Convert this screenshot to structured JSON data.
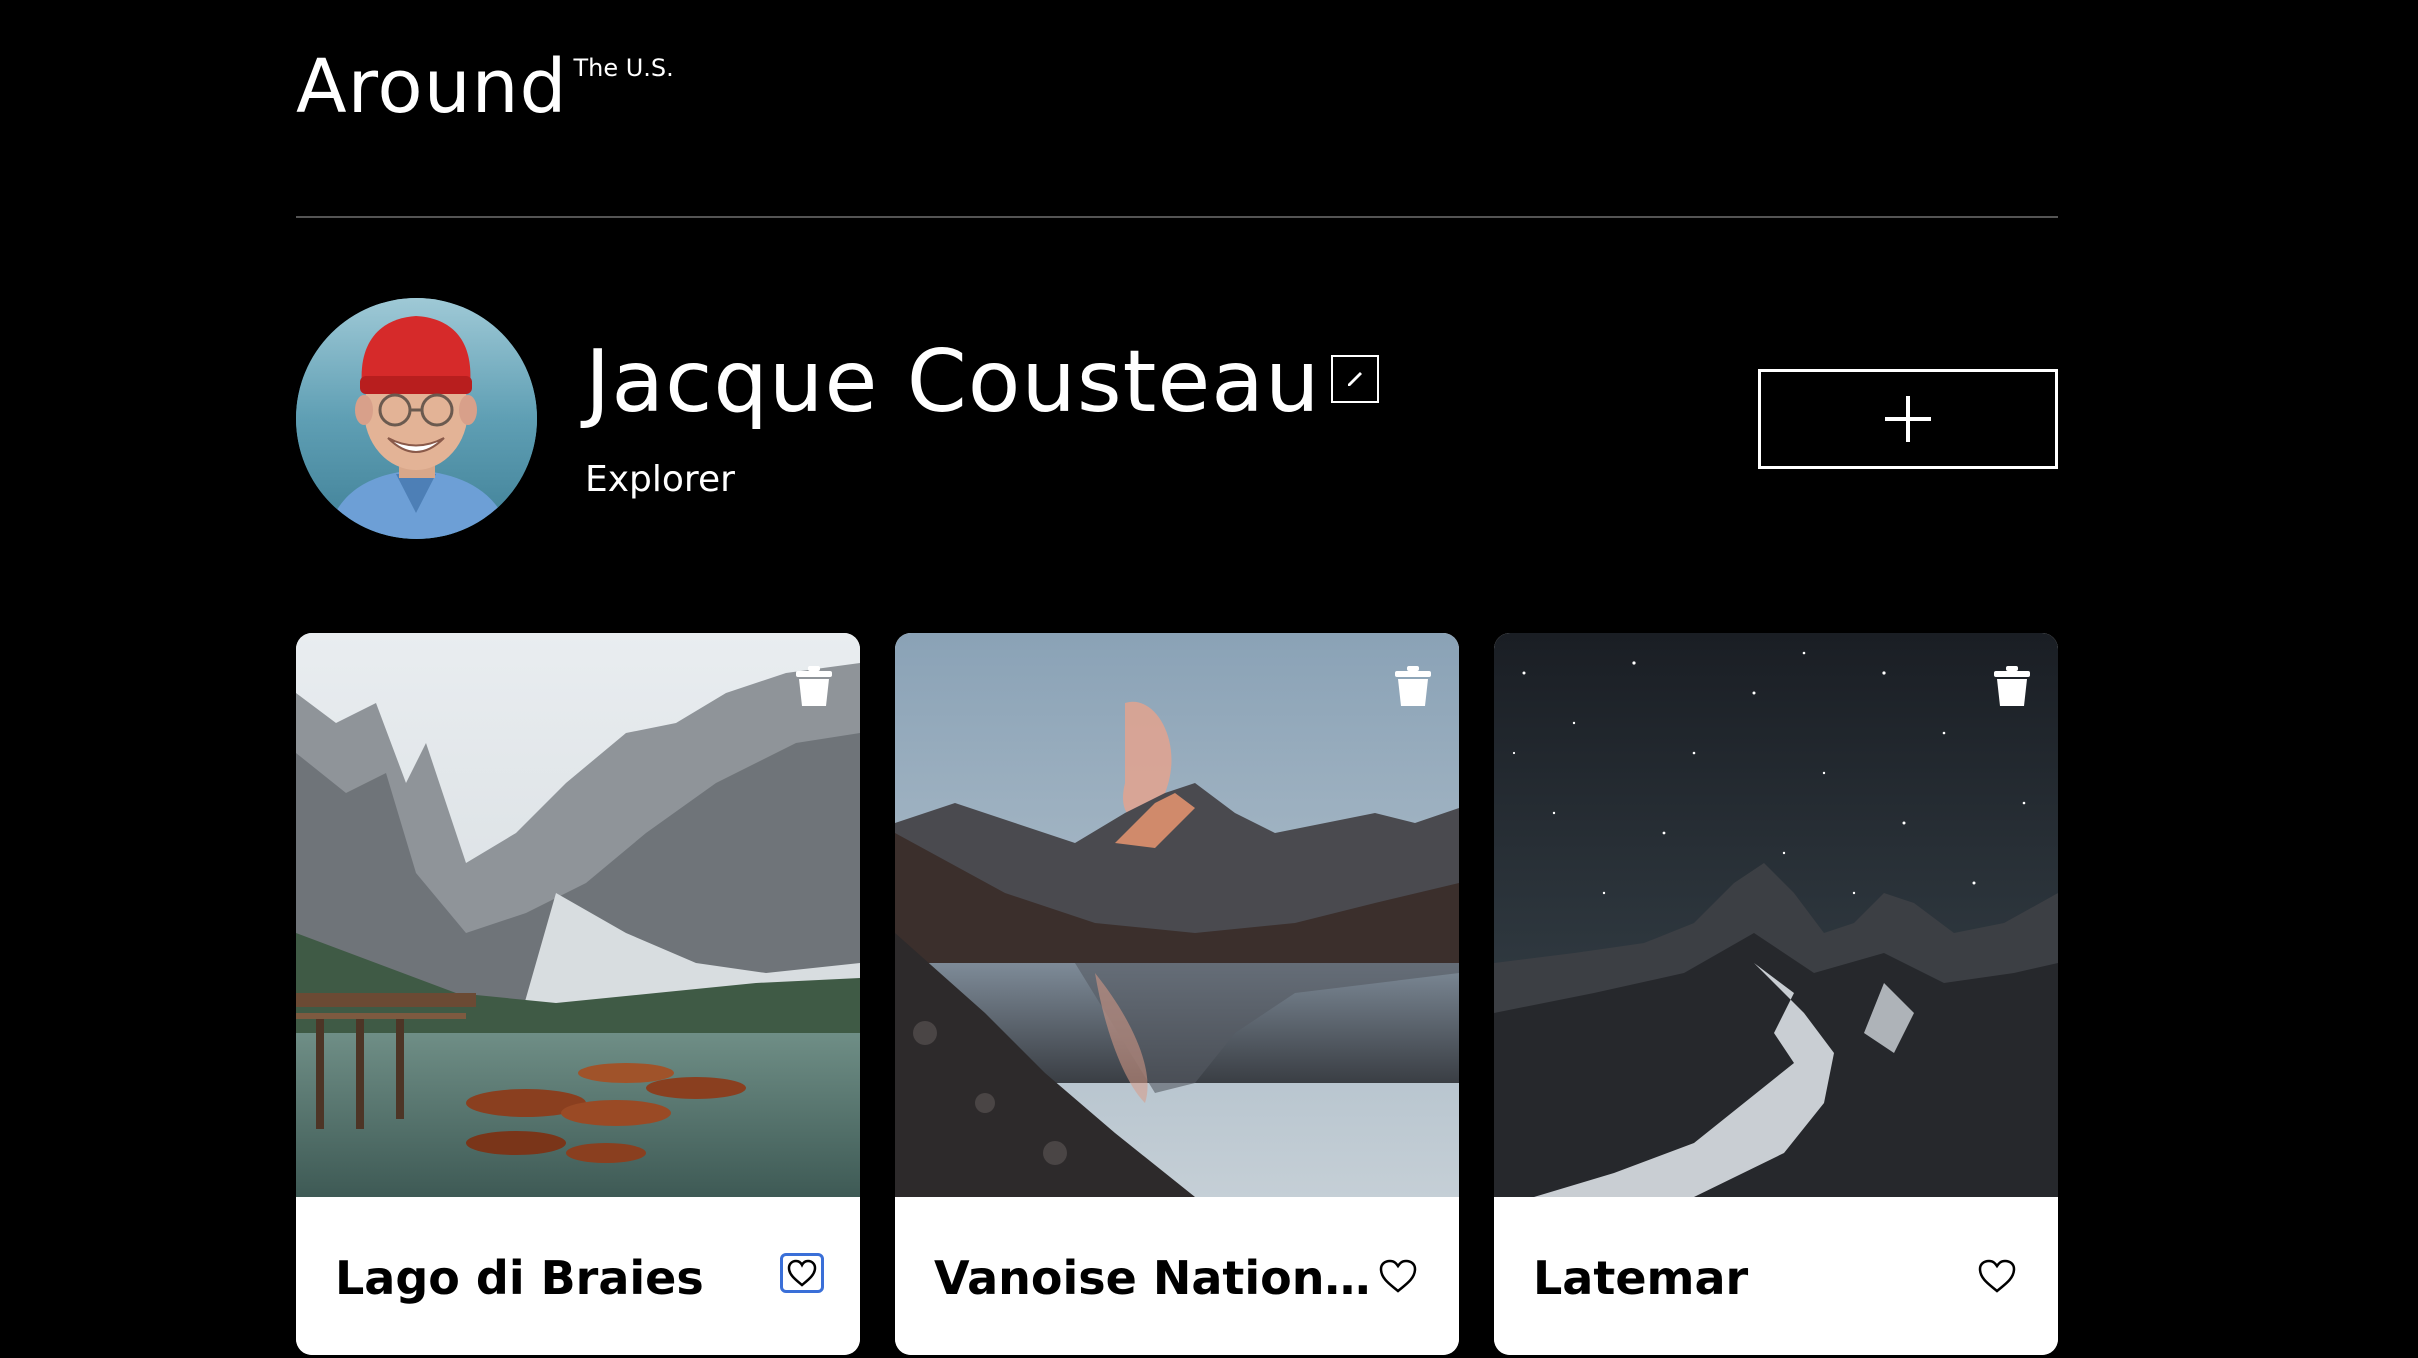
{
  "header": {
    "logo_main": "Around",
    "logo_sub": "The U.S."
  },
  "profile": {
    "name": "Jacque Cousteau",
    "about": "Explorer",
    "edit_icon": "pencil-icon",
    "add_icon": "plus-icon"
  },
  "cards": [
    {
      "title": "Lago di Braies",
      "liked": false,
      "like_focused": true,
      "icon_like": "heart-icon",
      "icon_delete": "trash-icon"
    },
    {
      "title": "Vanoise National Park",
      "liked": false,
      "like_focused": false,
      "icon_like": "heart-icon",
      "icon_delete": "trash-icon"
    },
    {
      "title": "Latemar",
      "liked": false,
      "like_focused": false,
      "icon_like": "heart-icon",
      "icon_delete": "trash-icon"
    }
  ],
  "colors": {
    "background": "#000000",
    "text": "#ffffff",
    "card": "#ffffff",
    "divider": "#545454",
    "focus_ring": "#3a6fd8"
  }
}
